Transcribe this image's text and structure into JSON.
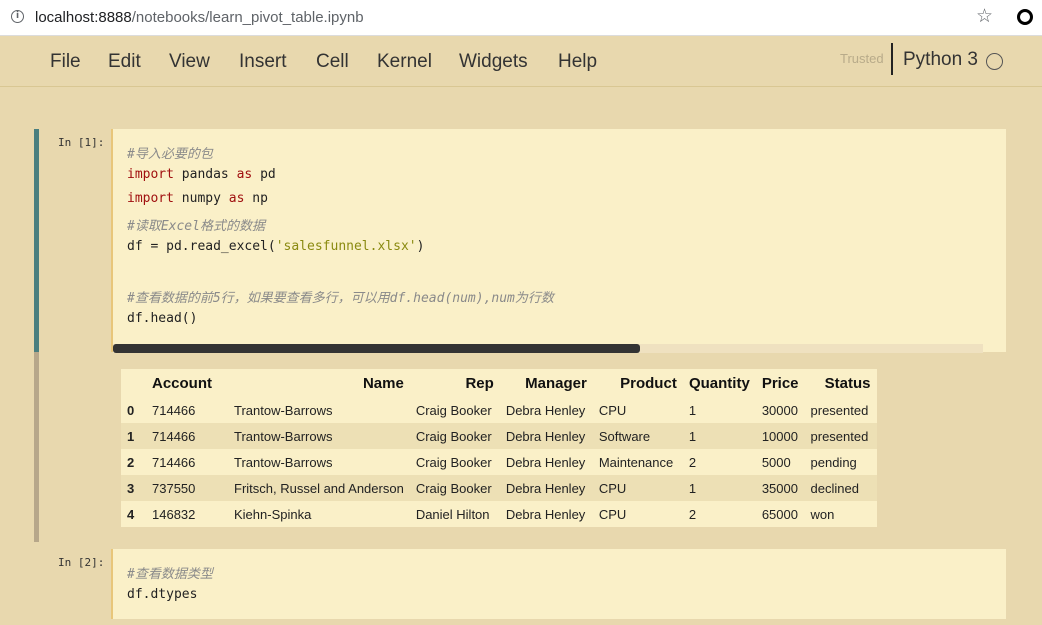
{
  "browser": {
    "url_host": "localhost:8888",
    "url_path": "/notebooks/learn_pivot_table.ipynb"
  },
  "menubar": {
    "items": [
      "File",
      "Edit",
      "View",
      "Insert",
      "Cell",
      "Kernel",
      "Widgets",
      "Help"
    ],
    "trusted": "Trusted",
    "kernel": "Python 3"
  },
  "cells": [
    {
      "prompt": "In  [1]:",
      "lines": [
        "#导入必要的包",
        "import pandas as pd",
        "import numpy as np",
        "#读取Excel格式的数据",
        "df = pd.read_excel('salesfunnel.xlsx')",
        "",
        "#查看数据的前5行，如果要查看多行，可以用df.head(num),num为行数",
        "df.head()"
      ]
    },
    {
      "prompt": "In  [2]:",
      "lines": [
        "#查看数据类型",
        "df.dtypes"
      ]
    }
  ],
  "dataframe": {
    "columns": [
      "",
      "Account",
      "Name",
      "Rep",
      "Manager",
      "Product",
      "Quantity",
      "Price",
      "Status"
    ],
    "rows": [
      [
        "0",
        "714466",
        "Trantow-Barrows",
        "Craig Booker",
        "Debra Henley",
        "CPU",
        "1",
        "30000",
        "presented"
      ],
      [
        "1",
        "714466",
        "Trantow-Barrows",
        "Craig Booker",
        "Debra Henley",
        "Software",
        "1",
        "10000",
        "presented"
      ],
      [
        "2",
        "714466",
        "Trantow-Barrows",
        "Craig Booker",
        "Debra Henley",
        "Maintenance",
        "2",
        "5000",
        "pending"
      ],
      [
        "3",
        "737550",
        "Fritsch, Russel and Anderson",
        "Craig Booker",
        "Debra Henley",
        "CPU",
        "1",
        "35000",
        "declined"
      ],
      [
        "4",
        "146832",
        "Kiehn-Spinka",
        "Daniel Hilton",
        "Debra Henley",
        "CPU",
        "2",
        "65000",
        "won"
      ]
    ]
  }
}
